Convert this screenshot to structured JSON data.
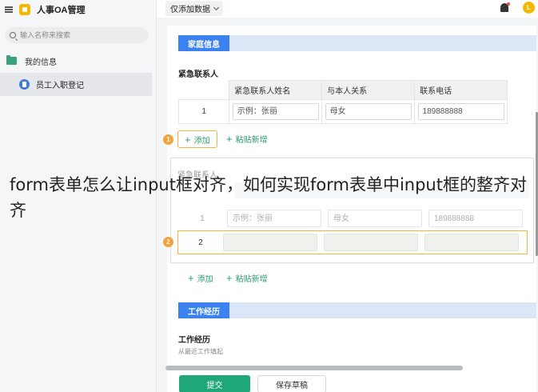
{
  "sidebar": {
    "app_title": "人事OA管理",
    "search_placeholder": "输入名称来搜索",
    "folder_label": "我的信息",
    "active_item": "员工入职登记"
  },
  "topbar": {
    "filter_label": "仅添加数据",
    "avatar_initial": "L"
  },
  "family": {
    "section_title": "家庭信息",
    "sub_label": "紧急联系人",
    "columns": [
      "紧急联系人姓名",
      "与本人关系",
      "联系电话"
    ],
    "rows": [
      {
        "num": "1",
        "name": "示例：张丽",
        "relation": "母女",
        "phone": "189888888"
      }
    ],
    "add_label": "添加",
    "paste_label": "粘贴新增"
  },
  "ghost": {
    "label": "紧急联系人",
    "row1": {
      "num": "1",
      "name": "示例：张丽",
      "relation": "母女",
      "phone": "189888888"
    },
    "row2_num": "2",
    "badge1": "1",
    "badge2": "2"
  },
  "second_actions": {
    "add_label": "添加",
    "paste_label": "粘贴新增"
  },
  "work": {
    "section_title": "工作经历",
    "label": "工作经历",
    "hint": "从最近工作填起"
  },
  "overlay_caption": "form表单怎么让input框对齐，如何实现form表单中input框的整齐对齐",
  "buttons": {
    "submit": "提交",
    "draft": "保存草稿"
  }
}
